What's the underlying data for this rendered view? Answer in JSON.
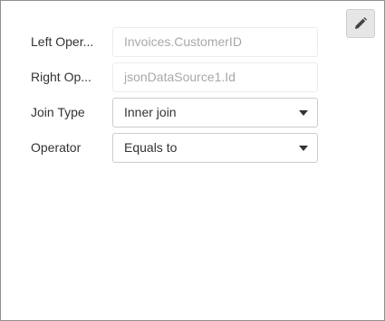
{
  "toolbar": {
    "edit_icon": "pencil-icon"
  },
  "fields": [
    {
      "label": "Left Oper...",
      "value": "Invoices.CustomerID"
    },
    {
      "label": "Right Op...",
      "value": "jsonDataSource1.Id"
    },
    {
      "label": "Join Type",
      "value": "Inner join"
    },
    {
      "label": "Operator",
      "value": "Equals to"
    }
  ]
}
